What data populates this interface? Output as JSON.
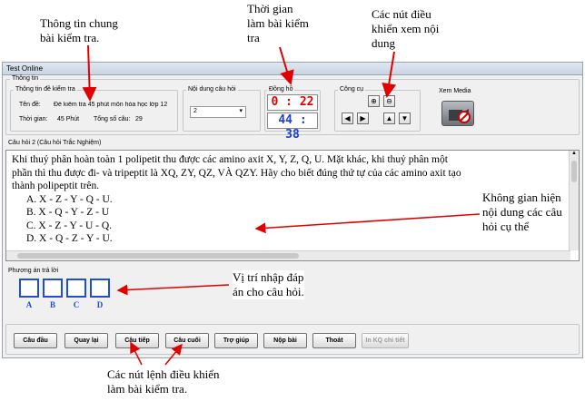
{
  "annotations": {
    "general_info": [
      "Thông tin chung",
      "bài kiểm tra."
    ],
    "time": [
      "Thời gian",
      "làm bài kiểm",
      "tra"
    ],
    "view_controls": [
      "Các nút điều",
      "khiển xem nội",
      "dung"
    ],
    "content_area": [
      "Không gian hiện",
      "nội dung các câu",
      "hỏi cụ thể"
    ],
    "answer_input": [
      "Vị trí nhập đáp",
      "án cho câu hỏi."
    ],
    "exam_controls": [
      "Các nút lệnh điều khiển",
      "làm bài kiểm tra."
    ]
  },
  "window": {
    "title": "Test Online"
  },
  "info": {
    "group_label": "Thông tin",
    "exam_group_label": "Thông tin đề kiểm tra",
    "name_label": "Tên đề:",
    "name_value": "Đề kiểm tra 45 phút môn hóa học lớp 12",
    "time_label": "Thời gian:",
    "time_value": "45 Phút",
    "count_label": "Tổng số câu:",
    "count_value": "29"
  },
  "content_select": {
    "label": "Nội dung câu hỏi",
    "value": "2"
  },
  "clock": {
    "label": "Đồng hồ",
    "remaining": "0 : 22",
    "elapsed": "44 : 38",
    "colors": {
      "remaining": "#e00000",
      "elapsed": "#1c3fd0"
    }
  },
  "tools": {
    "label": "Công cụ"
  },
  "media": {
    "label": "Xem Media"
  },
  "question": {
    "label": "Câu hỏi 2 (Câu hỏi Trắc Nghiệm)",
    "lines": [
      "Khi thuỷ phân hoàn toàn 1 polipetit thu được các amino axit  X, Y, Z, Q, U. Mặt khác, khi thuỷ phân một",
      "phần thì thu được đi- và tripeptit là XQ, ZY, QZ, VÀ QZY. Hãy cho biết đúng thứ tự của các amino axit tạo",
      "thành polipeptit trên."
    ],
    "options": [
      "A.   X - Z - Y - Q - U.",
      "B.   X - Q - Y - Z - U",
      "C.   X - Z - Y - U - Q.",
      "D.   X - Q - Z - Y - U."
    ]
  },
  "answer": {
    "label": "Phương án trả lời",
    "letters": [
      "A",
      "B",
      "C",
      "D"
    ]
  },
  "buttons": {
    "first": "Câu đầu",
    "back": "Quay lại",
    "next": "Câu tiếp",
    "last": "Câu cuối",
    "help": "Trợ giúp",
    "submit": "Nộp bài",
    "exit": "Thoát",
    "detail": "In KQ chi tiết"
  }
}
